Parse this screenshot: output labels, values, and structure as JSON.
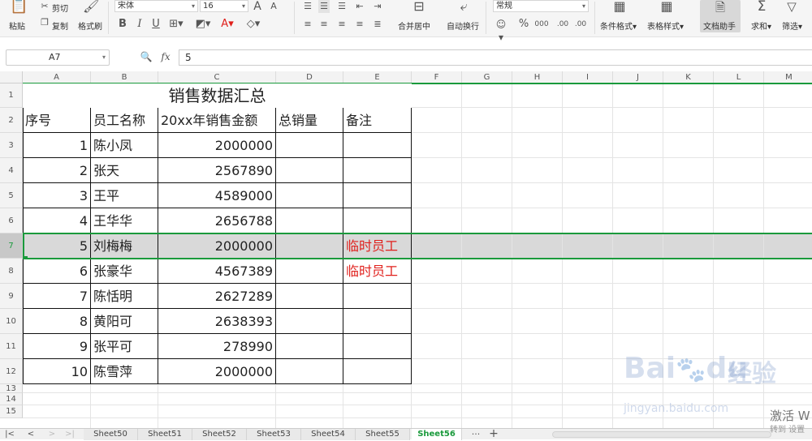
{
  "ribbon": {
    "paste_label": "粘贴",
    "cut_label": "剪切",
    "copy_label": "复制",
    "format_painter_label": "格式刷",
    "font_name": "宋体",
    "font_size": "16",
    "grow_font": "A",
    "shrink_font": "A",
    "bold": "B",
    "italic": "I",
    "underline": "U",
    "font_color_glyph": "A",
    "merge_center_label": "合并居中",
    "wrap_text_label": "自动换行",
    "number_format": "常规",
    "percent_glyph": "%",
    "thousands_glyph": "000",
    "inc_decimal_glyph": ".00",
    "dec_decimal_glyph": ".00",
    "cond_format_label": "条件格式",
    "table_style_label": "表格样式",
    "doc_assistant_label": "文档助手",
    "sum_label": "求和",
    "filter_label": "筛选"
  },
  "formula_bar": {
    "name_box": "A7",
    "fx_label": "fx",
    "value": "5"
  },
  "columns": [
    "A",
    "B",
    "C",
    "D",
    "E",
    "F",
    "G",
    "H",
    "I",
    "J",
    "K",
    "L",
    "M"
  ],
  "rows": [
    "1",
    "2",
    "3",
    "4",
    "5",
    "6",
    "7",
    "8",
    "9",
    "10",
    "11",
    "12",
    "13",
    "14",
    "15"
  ],
  "sheet": {
    "title": "销售数据汇总",
    "headers": [
      "序号",
      "员工名称",
      "20xx年销售金额",
      "总销量",
      "备注"
    ],
    "data": [
      {
        "id": "1",
        "name": "陈小凤",
        "amount": "2000000",
        "total": "",
        "note": ""
      },
      {
        "id": "2",
        "name": "张天",
        "amount": "2567890",
        "total": "",
        "note": ""
      },
      {
        "id": "3",
        "name": "王平",
        "amount": "4589000",
        "total": "",
        "note": ""
      },
      {
        "id": "4",
        "name": "王华华",
        "amount": "2656788",
        "total": "",
        "note": ""
      },
      {
        "id": "5",
        "name": "刘梅梅",
        "amount": "2000000",
        "total": "",
        "note": "临时员工"
      },
      {
        "id": "6",
        "name": "张豪华",
        "amount": "4567389",
        "total": "",
        "note": "临时员工"
      },
      {
        "id": "7",
        "name": "陈恬明",
        "amount": "2627289",
        "total": "",
        "note": ""
      },
      {
        "id": "8",
        "name": "黄阳可",
        "amount": "2638393",
        "total": "",
        "note": ""
      },
      {
        "id": "9",
        "name": "张平可",
        "amount": "278990",
        "total": "",
        "note": ""
      },
      {
        "id": "10",
        "name": "陈雪萍",
        "amount": "2000000",
        "total": "",
        "note": ""
      }
    ]
  },
  "tabs": [
    "Sheet50",
    "Sheet51",
    "Sheet52",
    "Sheet53",
    "Sheet54",
    "Sheet55",
    "Sheet56"
  ],
  "active_tab": "Sheet56",
  "tabs_more": "···",
  "tabs_add": "+",
  "watermark": {
    "brand": "Bai",
    "brand2": "du",
    "brand_cn": "经验",
    "url": "jingyan.baidu.com",
    "activate": "激活 W",
    "goto": "转到 设置"
  },
  "colors": {
    "selection_green": "#1a9a3c",
    "note_red": "#e0201c",
    "selected_row": "#d9d9d9"
  }
}
